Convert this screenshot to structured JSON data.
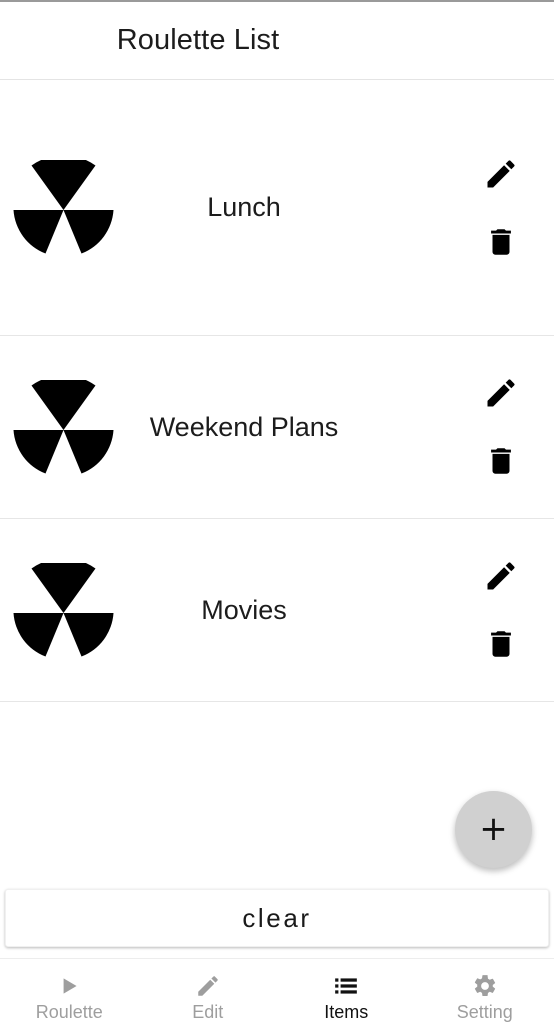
{
  "appbar": {
    "title": "Roulette List"
  },
  "list": {
    "rows": [
      {
        "label": "Lunch",
        "icon": "roulette-wheel-icon",
        "edit_icon": "pencil-icon",
        "delete_icon": "trash-icon"
      },
      {
        "label": "Weekend Plans",
        "icon": "roulette-wheel-icon",
        "edit_icon": "pencil-icon",
        "delete_icon": "trash-icon"
      },
      {
        "label": "Movies",
        "icon": "roulette-wheel-icon",
        "edit_icon": "pencil-icon",
        "delete_icon": "trash-icon"
      }
    ]
  },
  "fab": {
    "label": "+",
    "icon": "plus-icon"
  },
  "clear": {
    "label": "clear"
  },
  "bottom_nav": {
    "items": [
      {
        "label": "Roulette",
        "icon": "play-icon",
        "active": false
      },
      {
        "label": "Edit",
        "icon": "pencil-icon",
        "active": false
      },
      {
        "label": "Items",
        "icon": "list-icon",
        "active": true
      },
      {
        "label": "Setting",
        "icon": "gear-icon",
        "active": false
      }
    ]
  },
  "colors": {
    "text": "#1c1c1c",
    "inactive": "#9e9e9e",
    "active": "#111111",
    "fab_bg": "#d0d0d0",
    "divider": "#e6e6e6"
  }
}
